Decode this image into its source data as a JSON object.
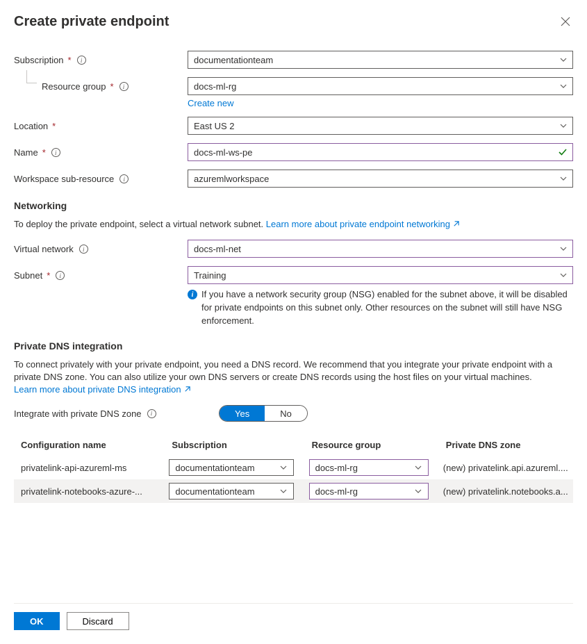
{
  "title": "Create private endpoint",
  "fields": {
    "subscription": {
      "label": "Subscription",
      "value": "documentationteam"
    },
    "resource_group": {
      "label": "Resource group",
      "value": "docs-ml-rg",
      "create_new": "Create new"
    },
    "location": {
      "label": "Location",
      "value": "East US 2"
    },
    "name": {
      "label": "Name",
      "value": "docs-ml-ws-pe"
    },
    "sub_resource": {
      "label": "Workspace sub-resource",
      "value": "azuremlworkspace"
    },
    "virtual_network": {
      "label": "Virtual network",
      "value": "docs-ml-net"
    },
    "subnet": {
      "label": "Subnet",
      "value": "Training"
    }
  },
  "networking": {
    "heading": "Networking",
    "text": "To deploy the private endpoint, select a virtual network subnet. ",
    "link": "Learn more about private endpoint networking",
    "nsg_info": "If you have a network security group (NSG) enabled for the subnet above, it will be disabled for private endpoints on this subnet only. Other resources on the subnet will still have NSG enforcement."
  },
  "dns": {
    "heading": "Private DNS integration",
    "text": "To connect privately with your private endpoint, you need a DNS record. We recommend that you integrate your private endpoint with a private DNS zone. You can also utilize your own DNS servers or create DNS records using the host files on your virtual machines.",
    "link": "Learn more about private DNS integration",
    "toggle_label": "Integrate with private DNS zone",
    "toggle_yes": "Yes",
    "toggle_no": "No",
    "table": {
      "headers": {
        "config": "Configuration name",
        "sub": "Subscription",
        "rg": "Resource group",
        "zone": "Private DNS zone"
      },
      "rows": [
        {
          "config": "privatelink-api-azureml-ms",
          "sub": "documentationteam",
          "rg": "docs-ml-rg",
          "zone": "(new) privatelink.api.azureml...."
        },
        {
          "config": "privatelink-notebooks-azure-...",
          "sub": "documentationteam",
          "rg": "docs-ml-rg",
          "zone": "(new) privatelink.notebooks.a..."
        }
      ]
    }
  },
  "footer": {
    "ok": "OK",
    "discard": "Discard"
  }
}
